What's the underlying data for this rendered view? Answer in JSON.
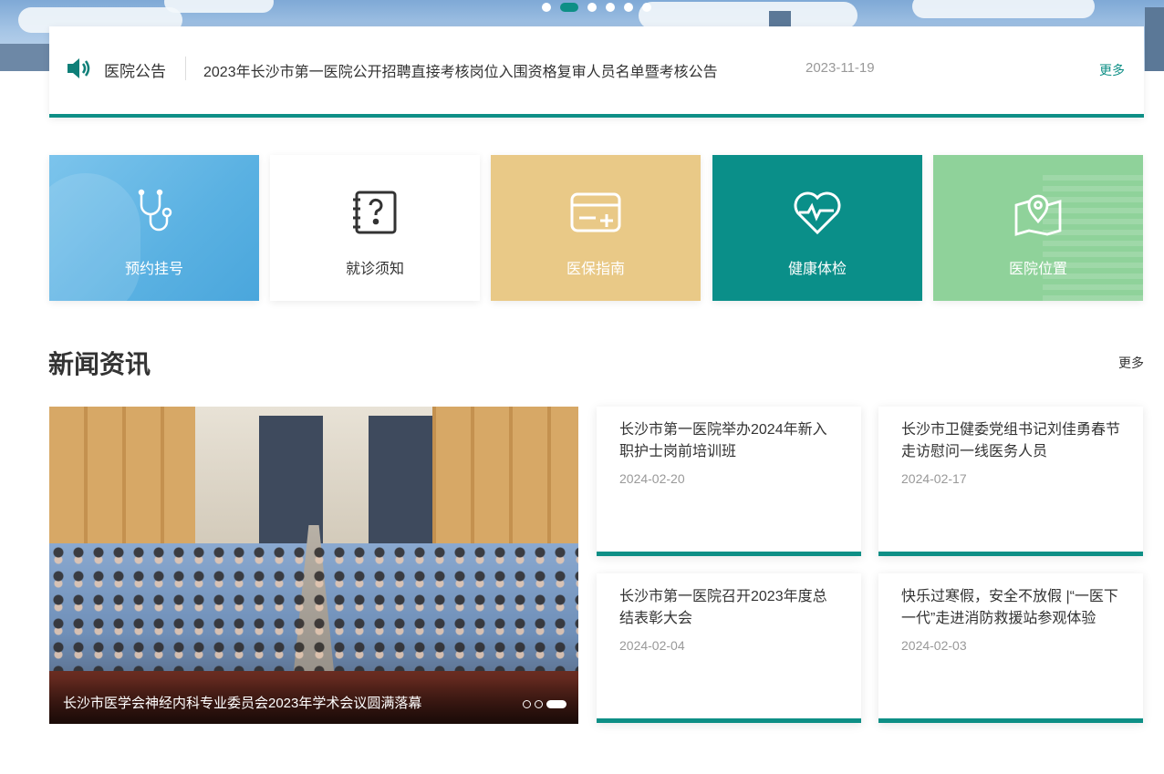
{
  "banner": {
    "slides": 6,
    "active_slide": 2
  },
  "notice": {
    "title": "医院公告",
    "text": "2023年长沙市第一医院公开招聘直接考核岗位入围资格复审人员名单暨考核公告",
    "date": "2023-11-19",
    "more": "更多",
    "icon": "speaker-icon"
  },
  "quick_links": [
    {
      "label": "预约挂号",
      "icon": "stethoscope-icon",
      "color": "#5ab1e2"
    },
    {
      "label": "就诊须知",
      "icon": "question-book-icon",
      "color": "#ffffff"
    },
    {
      "label": "医保指南",
      "icon": "card-plus-icon",
      "color": "#e9c987"
    },
    {
      "label": "健康体检",
      "icon": "heart-pulse-icon",
      "color": "#0a8f89"
    },
    {
      "label": "医院位置",
      "icon": "map-pin-icon",
      "color": "#8fd29a"
    }
  ],
  "news": {
    "title": "新闻资讯",
    "more": "更多",
    "featured": {
      "caption": "长沙市医学会神经内科专业委员会2023年学术会议圆满落幕",
      "slides": 3,
      "active_slide": 3
    },
    "items": [
      {
        "title": "长沙市第一医院举办2024年新入职护士岗前培训班",
        "date": "2024-02-20"
      },
      {
        "title": "长沙市卫健委党组书记刘佳勇春节走访慰问一线医务人员",
        "date": "2024-02-17"
      },
      {
        "title": "长沙市第一医院召开2023年度总结表彰大会",
        "date": "2024-02-04"
      },
      {
        "title": "快乐过寒假，安全不放假 |“一医下一代”走进消防救援站参观体验",
        "date": "2024-02-03"
      }
    ]
  },
  "accent_color": "#0e8f86"
}
